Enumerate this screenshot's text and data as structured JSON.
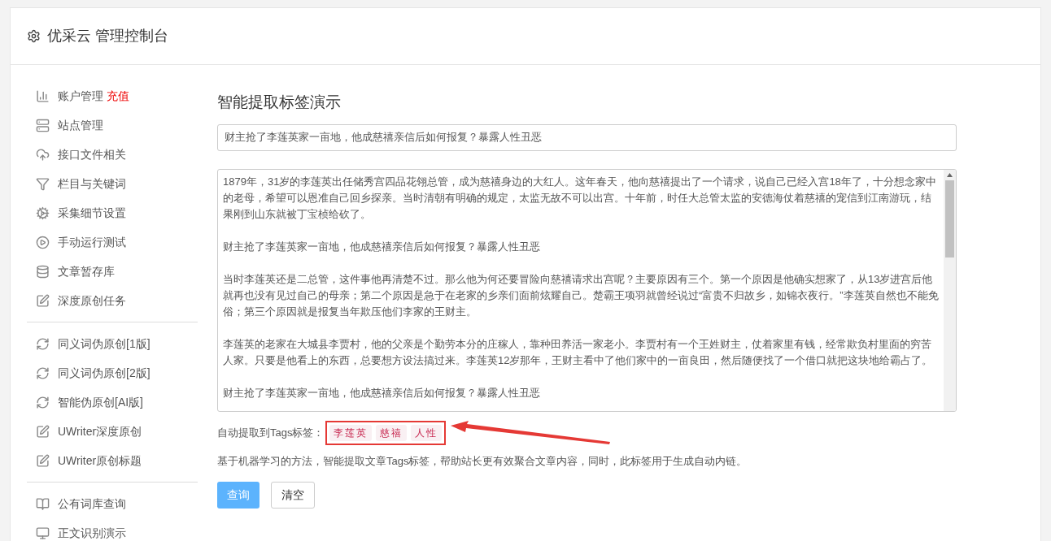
{
  "header": {
    "title": "优采云 管理控制台"
  },
  "sidebar": {
    "groups": [
      [
        {
          "kind": "chart",
          "label": "账户管理",
          "badge": "充值"
        },
        {
          "kind": "server",
          "label": "站点管理"
        },
        {
          "kind": "cloud",
          "label": "接口文件相关"
        },
        {
          "kind": "filter",
          "label": "栏目与关键词"
        },
        {
          "kind": "cogs",
          "label": "采集细节设置"
        },
        {
          "kind": "play",
          "label": "手动运行测试"
        },
        {
          "kind": "database",
          "label": "文章暂存库"
        },
        {
          "kind": "edit",
          "label": "深度原创任务"
        }
      ],
      [
        {
          "kind": "refresh",
          "label": "同义词伪原创[1版]"
        },
        {
          "kind": "refresh",
          "label": "同义词伪原创[2版]"
        },
        {
          "kind": "refresh",
          "label": "智能伪原创[AI版]"
        },
        {
          "kind": "edit",
          "label": "UWriter深度原创"
        },
        {
          "kind": "edit",
          "label": "UWriter原创标题"
        }
      ],
      [
        {
          "kind": "book",
          "label": "公有词库查询"
        },
        {
          "kind": "monitor",
          "label": "正文识别演示"
        }
      ]
    ]
  },
  "main": {
    "title": "智能提取标签演示",
    "title_field": {
      "value": "财主抢了李莲英家一亩地，他成慈禧亲信后如何报复？暴露人性丑恶"
    },
    "content_paragraphs": [
      "1879年，31岁的李莲英出任储秀宫四品花翎总管，成为慈禧身边的大红人。这年春天，他向慈禧提出了一个请求，说自己已经入宫18年了，十分想念家中的老母，希望可以恩准自己回乡探亲。当时清朝有明确的规定，太监无故不可以出宫。十年前，时任大总管太监的安德海仗着慈禧的宠信到江南游玩，结果刚到山东就被丁宝桢给砍了。",
      "财主抢了李莲英家一亩地，他成慈禧亲信后如何报复？暴露人性丑恶",
      "当时李莲英还是二总管，这件事他再清楚不过。那么他为何还要冒险向慈禧请求出宫呢？主要原因有三个。第一个原因是他确实想家了，从13岁进宫后他就再也没有见过自己的母亲；第二个原因是急于在老家的乡亲们面前炫耀自己。楚霸王项羽就曾经说过“富贵不归故乡，如锦衣夜行。”李莲英自然也不能免俗；第三个原因就是报复当年欺压他们李家的王财主。",
      "李莲英的老家在大城县李贾村，他的父亲是个勤劳本分的庄稼人，靠种田养活一家老小。李贾村有一个王姓财主，仗着家里有钱，经常欺负村里面的穷苦人家。只要是他看上的东西，总要想方设法搞过来。李莲英12岁那年，王财主看中了他们家中的一亩良田，然后随便找了一个借口就把这块地给霸占了。",
      "财主抢了李莲英家一亩地，他成慈禧亲信后如何报复？暴露人性丑恶"
    ],
    "tags_label": "自动提取到Tags标签：",
    "tags": [
      "李莲英",
      "慈禧",
      "人性"
    ],
    "description": "基于机器学习的方法，智能提取文章Tags标签，帮助站长更有效聚合文章内容，同时，此标签用于生成自动内链。",
    "buttons": [
      {
        "label": "查询",
        "kind": "primary"
      },
      {
        "label": "清空",
        "kind": "default"
      }
    ]
  }
}
